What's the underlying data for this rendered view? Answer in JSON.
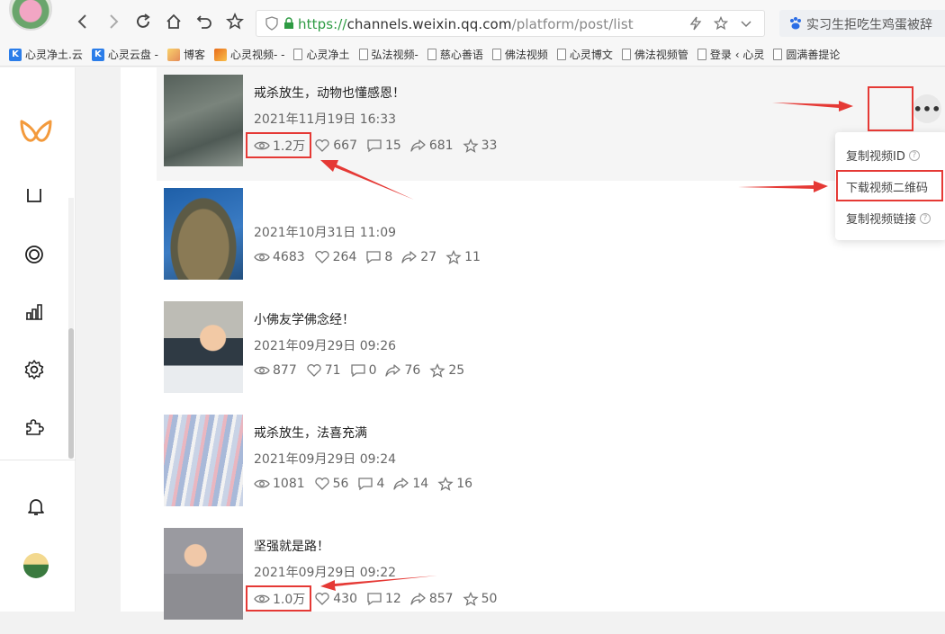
{
  "browser": {
    "url_protocol": "https://",
    "url_host": "channels.weixin.qq.com",
    "url_path": "/platform/post/list",
    "search_text": "实习生拒吃生鸡蛋被辞"
  },
  "bookmarks": [
    {
      "label": "心灵净土.云",
      "icon": "k-icon"
    },
    {
      "label": "心灵云盘 -",
      "icon": "k-icon"
    },
    {
      "label": "博客",
      "icon": "blog-icon"
    },
    {
      "label": "心灵视频- -",
      "icon": "video-icon"
    },
    {
      "label": "心灵净土",
      "icon": "page-icon"
    },
    {
      "label": "弘法视频-",
      "icon": "page-icon"
    },
    {
      "label": "慈心善语",
      "icon": "page-icon"
    },
    {
      "label": "佛法视频",
      "icon": "page-icon"
    },
    {
      "label": "心灵博文",
      "icon": "page-icon"
    },
    {
      "label": "佛法视频管",
      "icon": "page-icon"
    },
    {
      "label": "登录 ‹ 心灵",
      "icon": "page-icon"
    },
    {
      "label": "圆满善提论",
      "icon": "page-icon"
    }
  ],
  "posts": [
    {
      "title": "戒杀放生，动物也懂感恩！",
      "date": "2021年11月19日 16:33",
      "views": "1.2万",
      "likes": "667",
      "comments": "15",
      "shares": "681",
      "favs": "33"
    },
    {
      "title": "",
      "date": "2021年10月31日 11:09",
      "views": "4683",
      "likes": "264",
      "comments": "8",
      "shares": "27",
      "favs": "11"
    },
    {
      "title": "小佛友学佛念经！",
      "date": "2021年09月29日 09:26",
      "views": "877",
      "likes": "71",
      "comments": "0",
      "shares": "76",
      "favs": "25"
    },
    {
      "title": "戒杀放生，法喜充满",
      "date": "2021年09月29日 09:24",
      "views": "1081",
      "likes": "56",
      "comments": "4",
      "shares": "14",
      "favs": "16"
    },
    {
      "title": "坚强就是路！",
      "date": "2021年09月29日 09:22",
      "views": "1.0万",
      "likes": "430",
      "comments": "12",
      "shares": "857",
      "favs": "50"
    }
  ],
  "more_menu": {
    "button": "•••",
    "items": [
      "复制视频ID",
      "下载视频二维码",
      "复制视频链接"
    ],
    "help": "?"
  },
  "colors": {
    "annotation": "#e53935",
    "url_green": "#2e9b43",
    "logo_orange": "#f39a3c"
  }
}
